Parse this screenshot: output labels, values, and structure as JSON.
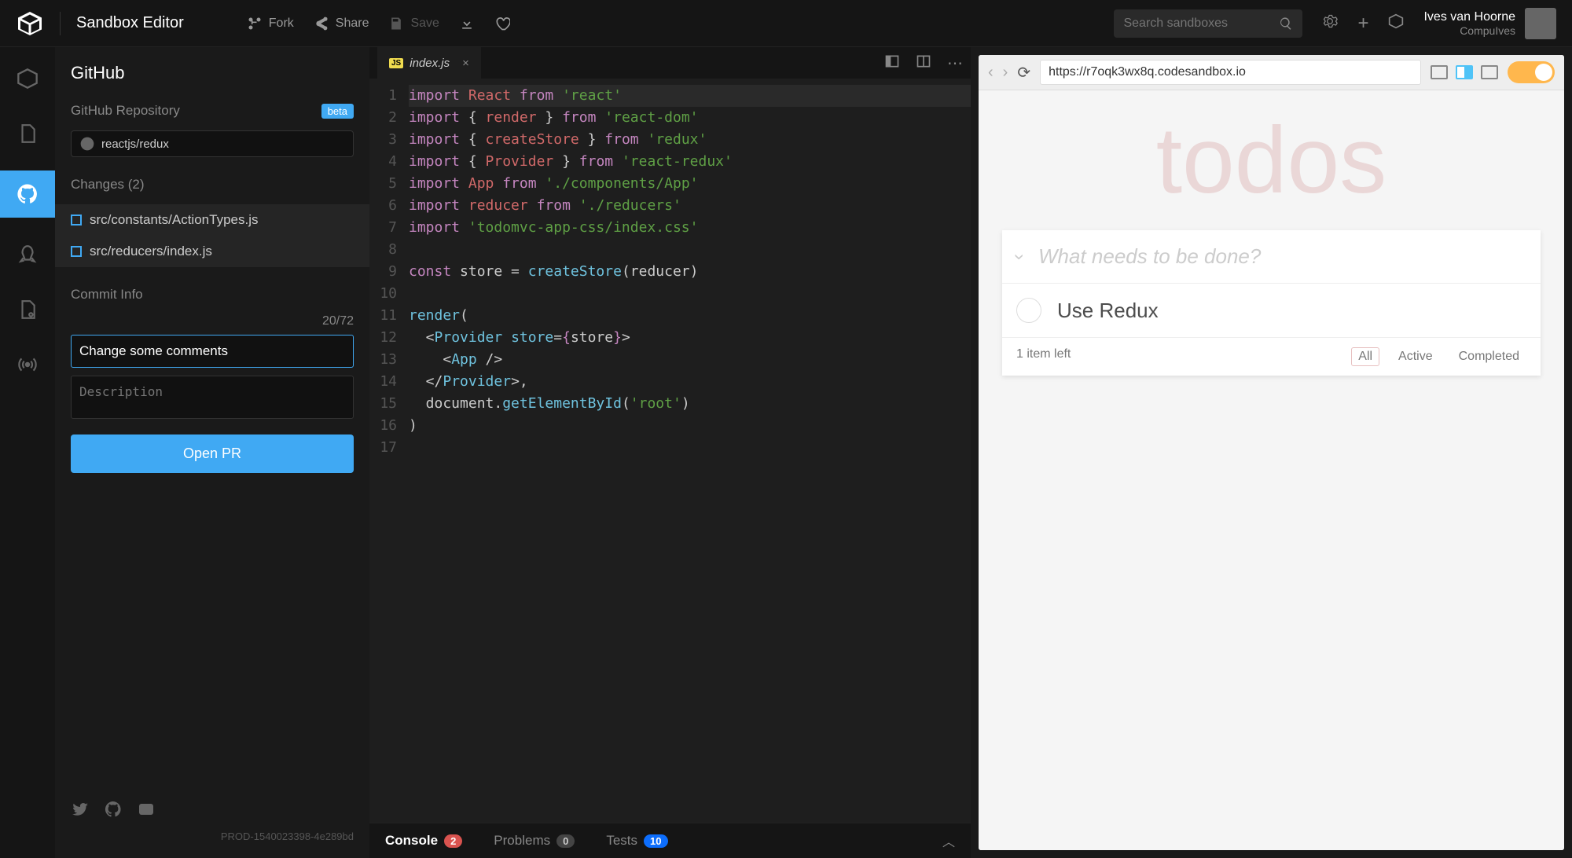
{
  "app": {
    "title": "Sandbox Editor"
  },
  "topbar": {
    "fork": "Fork",
    "share": "Share",
    "save": "Save",
    "search_placeholder": "Search sandboxes"
  },
  "user": {
    "name": "Ives van Hoorne",
    "org": "CompuIves"
  },
  "panel": {
    "title": "GitHub",
    "repo_label": "GitHub Repository",
    "beta": "beta",
    "repo_value": "reactjs/redux",
    "changes_label": "Changes (2)",
    "changes": [
      "src/constants/ActionTypes.js",
      "src/reducers/index.js"
    ],
    "commit_info_label": "Commit Info",
    "char_count": "20/72",
    "commit_title": "Change some comments",
    "desc_placeholder": "Description",
    "open_pr": "Open PR",
    "build_id": "PROD-1540023398-4e289bd"
  },
  "editor": {
    "tab_name": "index.js",
    "code_lines": [
      {
        "n": 1,
        "segs": [
          [
            "kw",
            "import "
          ],
          [
            "fn",
            "React"
          ],
          [
            "pl",
            " "
          ],
          [
            "kw",
            "from"
          ],
          [
            "pl",
            " "
          ],
          [
            "str",
            "'react'"
          ]
        ]
      },
      {
        "n": 2,
        "segs": [
          [
            "kw",
            "import "
          ],
          [
            "pl",
            "{ "
          ],
          [
            "fn",
            "render"
          ],
          [
            "pl",
            " } "
          ],
          [
            "kw",
            "from"
          ],
          [
            "pl",
            " "
          ],
          [
            "str",
            "'react-dom'"
          ]
        ]
      },
      {
        "n": 3,
        "segs": [
          [
            "kw",
            "import "
          ],
          [
            "pl",
            "{ "
          ],
          [
            "fn",
            "createStore"
          ],
          [
            "pl",
            " } "
          ],
          [
            "kw",
            "from"
          ],
          [
            "pl",
            " "
          ],
          [
            "str",
            "'redux'"
          ]
        ]
      },
      {
        "n": 4,
        "segs": [
          [
            "kw",
            "import "
          ],
          [
            "pl",
            "{ "
          ],
          [
            "fn",
            "Provider"
          ],
          [
            "pl",
            " } "
          ],
          [
            "kw",
            "from"
          ],
          [
            "pl",
            " "
          ],
          [
            "str",
            "'react-redux'"
          ]
        ]
      },
      {
        "n": 5,
        "segs": [
          [
            "kw",
            "import "
          ],
          [
            "fn",
            "App"
          ],
          [
            "pl",
            " "
          ],
          [
            "kw",
            "from"
          ],
          [
            "pl",
            " "
          ],
          [
            "str",
            "'./components/App'"
          ]
        ]
      },
      {
        "n": 6,
        "segs": [
          [
            "kw",
            "import "
          ],
          [
            "fn",
            "reducer"
          ],
          [
            "pl",
            " "
          ],
          [
            "kw",
            "from"
          ],
          [
            "pl",
            " "
          ],
          [
            "str",
            "'./reducers'"
          ]
        ]
      },
      {
        "n": 7,
        "segs": [
          [
            "kw",
            "import "
          ],
          [
            "str",
            "'todomvc-app-css/index.css'"
          ]
        ]
      },
      {
        "n": 8,
        "segs": []
      },
      {
        "n": 9,
        "segs": [
          [
            "kw",
            "const "
          ],
          [
            "pl",
            "store = "
          ],
          [
            "id",
            "createStore"
          ],
          [
            "pl",
            "(reducer)"
          ]
        ]
      },
      {
        "n": 10,
        "segs": []
      },
      {
        "n": 11,
        "segs": [
          [
            "id",
            "render"
          ],
          [
            "pl",
            "("
          ]
        ]
      },
      {
        "n": 12,
        "segs": [
          [
            "pl",
            "  <"
          ],
          [
            "id",
            "Provider"
          ],
          [
            "pl",
            " "
          ],
          [
            "id",
            "store"
          ],
          [
            "pl",
            "="
          ],
          [
            "kw",
            "{"
          ],
          [
            "pl",
            "store"
          ],
          [
            "kw",
            "}"
          ],
          [
            "pl",
            ">"
          ]
        ]
      },
      {
        "n": 13,
        "segs": [
          [
            "pl",
            "    <"
          ],
          [
            "id",
            "App"
          ],
          [
            "pl",
            " />"
          ]
        ]
      },
      {
        "n": 14,
        "segs": [
          [
            "pl",
            "  </"
          ],
          [
            "id",
            "Provider"
          ],
          [
            "pl",
            ">,"
          ]
        ]
      },
      {
        "n": 15,
        "segs": [
          [
            "pl",
            "  document."
          ],
          [
            "id",
            "getElementById"
          ],
          [
            "pl",
            "("
          ],
          [
            "str",
            "'root'"
          ],
          [
            "pl",
            ")"
          ]
        ]
      },
      {
        "n": 16,
        "segs": [
          [
            "pl",
            ")"
          ]
        ]
      },
      {
        "n": 17,
        "segs": []
      }
    ]
  },
  "bottom_tabs": {
    "console": "Console",
    "console_badge": "2",
    "problems": "Problems",
    "problems_badge": "0",
    "tests": "Tests",
    "tests_badge": "10"
  },
  "preview": {
    "url": "https://r7oqk3wx8q.codesandbox.io",
    "todo_title": "todos",
    "todo_placeholder": "What needs to be done?",
    "todo_item": "Use Redux",
    "items_left": "1 item left",
    "filters": {
      "all": "All",
      "active": "Active",
      "completed": "Completed"
    }
  }
}
